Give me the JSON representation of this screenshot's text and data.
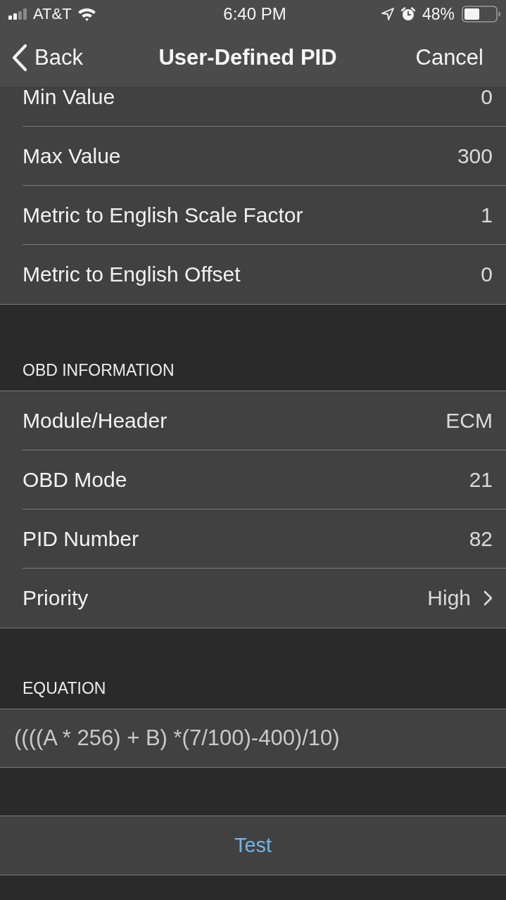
{
  "status_bar": {
    "carrier": "AT&T",
    "time": "6:40 PM",
    "battery": "48%"
  },
  "nav_bar": {
    "back": "Back",
    "title": "User-Defined PID",
    "cancel": "Cancel"
  },
  "scale_section": {
    "rows": [
      {
        "label": "Min Value",
        "value": "0",
        "kind": "value"
      },
      {
        "label": "Max Value",
        "value": "300",
        "kind": "value"
      },
      {
        "label": "Metric to English Scale Factor",
        "value": "1",
        "kind": "value"
      },
      {
        "label": "Metric to English Offset",
        "value": "0",
        "kind": "value"
      }
    ]
  },
  "obd_section": {
    "header": "OBD INFORMATION",
    "rows": [
      {
        "label": "Module/Header",
        "value": "ECM",
        "kind": "value"
      },
      {
        "label": "OBD Mode",
        "value": "21",
        "kind": "value"
      },
      {
        "label": "PID Number",
        "value": "82",
        "kind": "value"
      },
      {
        "label": "Priority",
        "value": "High",
        "kind": "picker"
      }
    ]
  },
  "equation_section": {
    "header": "EQUATION",
    "value": "((((A * 256) + B) *(7/100)-400)/10)"
  },
  "test_button": {
    "label": "Test"
  }
}
